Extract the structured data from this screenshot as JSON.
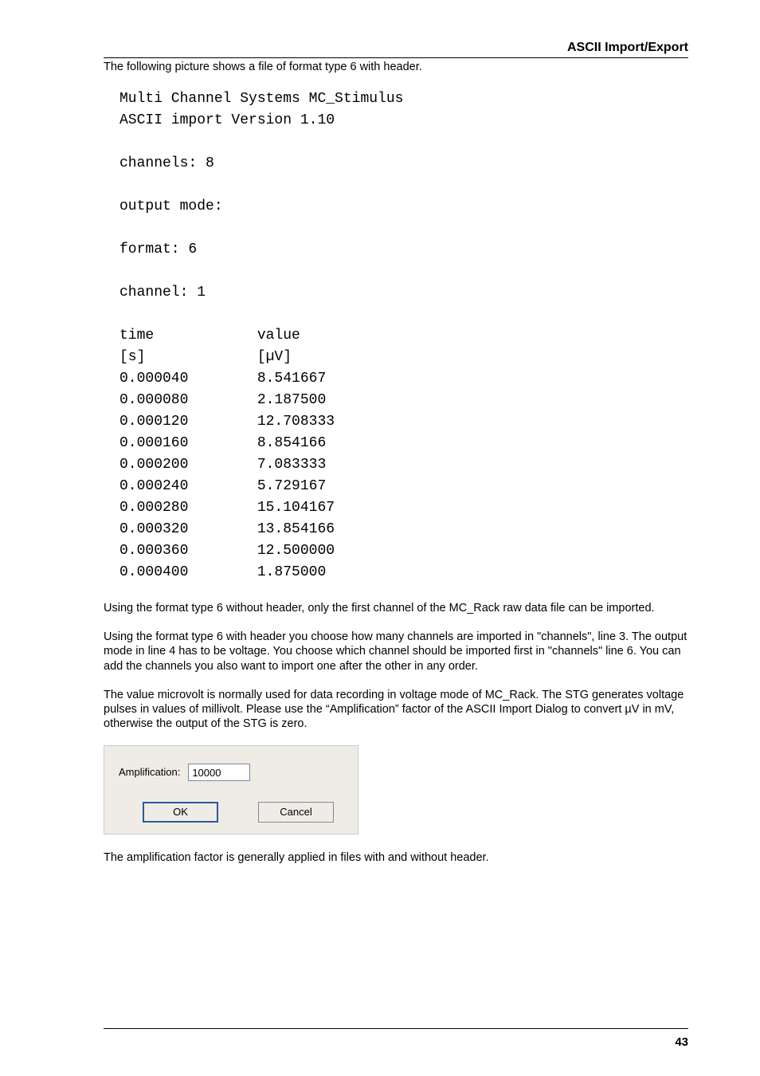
{
  "header": "ASCII Import/Export",
  "intro": "The following picture shows a file of format type 6 with header.",
  "file": {
    "title1": "Multi Channel Systems MC_Stimulus",
    "title2": "ASCII import Version 1.10",
    "channels_line": "channels: 8",
    "output_mode_line": "output mode:",
    "format_line": "format: 6",
    "channel_line": "channel: 1",
    "col1_header": "time",
    "col2_header": "value",
    "col1_unit": "[s]",
    "col2_unit": "[µV]",
    "rows": [
      {
        "t": "0.000040",
        "v": "8.541667"
      },
      {
        "t": "0.000080",
        "v": "2.187500"
      },
      {
        "t": "0.000120",
        "v": "12.708333"
      },
      {
        "t": "0.000160",
        "v": "8.854166"
      },
      {
        "t": "0.000200",
        "v": "7.083333"
      },
      {
        "t": "0.000240",
        "v": "5.729167"
      },
      {
        "t": "0.000280",
        "v": "15.104167"
      },
      {
        "t": "0.000320",
        "v": "13.854166"
      },
      {
        "t": "0.000360",
        "v": "12.500000"
      },
      {
        "t": "0.000400",
        "v": "1.875000"
      }
    ]
  },
  "para1": "Using the format type 6 without header, only the first channel of the MC_Rack raw data file can be imported.",
  "para2": "Using the format type 6 with header you choose how many channels are imported in \"channels\", line 3.  The output mode in line 4 has to be voltage. You choose which channel should be imported first in \"channels\" line 6. You can add the channels you also want to import one after the other in any order.",
  "para3": "The value microvolt is normally used for data recording in voltage mode of MC_Rack. The STG generates voltage pulses in values of millivolt. Please use the “Amplification” factor of the ASCII Import Dialog to convert µV in mV, otherwise the output of the STG is zero.",
  "dialog": {
    "label": "Amplification:",
    "value": "10000",
    "ok": "OK",
    "cancel": "Cancel"
  },
  "para4": "The amplification factor is generally applied in files with and without header.",
  "pageNumber": "43"
}
